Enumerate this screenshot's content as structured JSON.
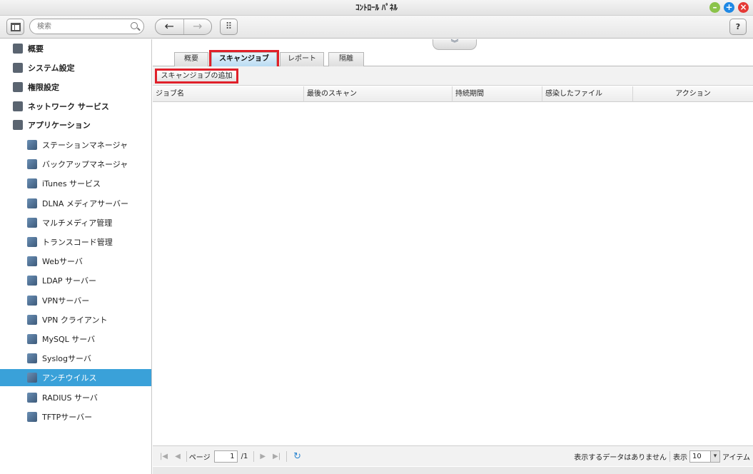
{
  "window": {
    "title": "ｺﾝﾄﾛｰﾙ ﾊﾟﾈﾙ"
  },
  "toolbar": {
    "search_placeholder": "検索",
    "back_glyph": "←",
    "forward_glyph": "→",
    "apps_glyph": "⠿",
    "help_label": "?",
    "sidebar_toggle_icon": "sidebar-layout-icon"
  },
  "sidebar": {
    "top_items": [
      {
        "label": "概要",
        "icon": "grid-icon"
      },
      {
        "label": "システム設定",
        "icon": "gear-icon"
      },
      {
        "label": "権限設定",
        "icon": "user-icon"
      },
      {
        "label": "ネットワーク サービス",
        "icon": "network-icon"
      },
      {
        "label": "アプリケーション",
        "icon": "inbox-icon"
      }
    ],
    "apps": [
      {
        "label": "ステーションマネージャ",
        "icon": "station-manager-icon"
      },
      {
        "label": "バックアップマネージャ",
        "icon": "backup-icon"
      },
      {
        "label": "iTunes サービス",
        "icon": "itunes-icon"
      },
      {
        "label": "DLNA メディアサーバー",
        "icon": "dlna-icon"
      },
      {
        "label": "マルチメディア管理",
        "icon": "multimedia-icon"
      },
      {
        "label": "トランスコード管理",
        "icon": "transcode-icon"
      },
      {
        "label": "Webサーバ",
        "icon": "globe-icon"
      },
      {
        "label": "LDAP サーバー",
        "icon": "ldap-icon"
      },
      {
        "label": "VPNサーバー",
        "icon": "vpn-server-icon"
      },
      {
        "label": "VPN クライアント",
        "icon": "vpn-client-icon"
      },
      {
        "label": "MySQL サーバ",
        "icon": "mysql-icon"
      },
      {
        "label": "Syslogサーバ",
        "icon": "syslog-icon"
      },
      {
        "label": "アンチウイルス",
        "icon": "antivirus-icon",
        "active": true
      },
      {
        "label": "RADIUS サーバ",
        "icon": "radius-icon"
      },
      {
        "label": "TFTPサーバー",
        "icon": "tftp-icon"
      }
    ]
  },
  "main": {
    "tabs": [
      "概要",
      "スキャンジョブ",
      "レポート",
      "隔離"
    ],
    "selected_tab": "スキャンジョブ",
    "add_job_label": "スキャンジョブの追加",
    "columns": [
      "ジョブ名",
      "最後のスキャン",
      "持続期間",
      "感染したファイル",
      "アクション"
    ],
    "rows": []
  },
  "pager": {
    "page_label": "ページ",
    "page_value": "1",
    "total_pages": "/1",
    "status": "表示するデータはありません",
    "show_label": "表示",
    "per_page": "10",
    "items_label": "アイテム"
  },
  "colors": {
    "accent": "#3aa1d9",
    "highlight": "#e0202a"
  }
}
